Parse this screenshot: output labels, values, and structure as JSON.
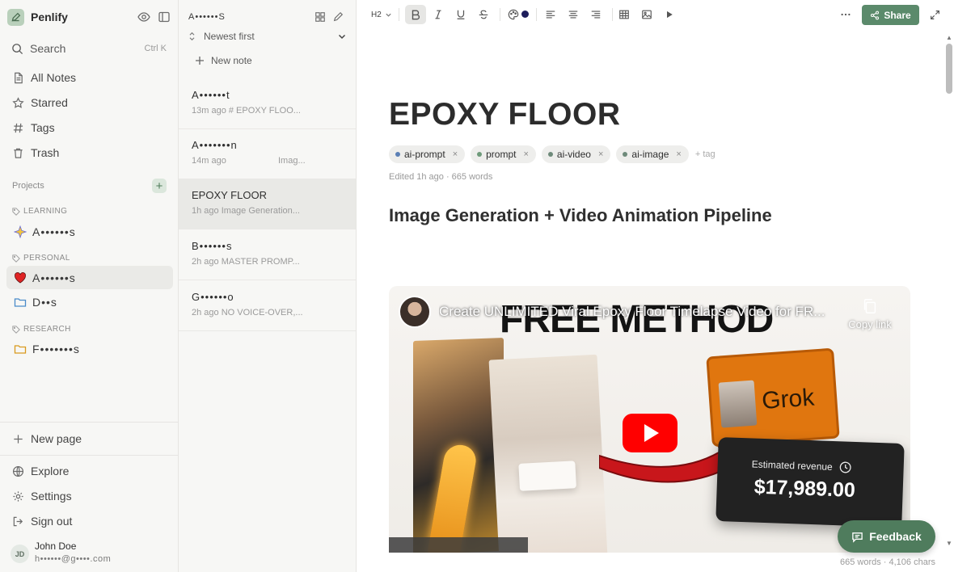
{
  "app": {
    "name": "Penlify"
  },
  "sidebar": {
    "search": {
      "label": "Search",
      "shortcut": "Ctrl K"
    },
    "nav": [
      {
        "label": "All Notes",
        "icon": "document-icon"
      },
      {
        "label": "Starred",
        "icon": "star-icon"
      },
      {
        "label": "Tags",
        "icon": "hash-icon"
      },
      {
        "label": "Trash",
        "icon": "trash-icon"
      }
    ],
    "projects_label": "Projects",
    "groups": [
      {
        "name": "LEARNING",
        "items": [
          {
            "label": "A••••••s",
            "icon": "sparkle-icon"
          }
        ]
      },
      {
        "name": "PERSONAL",
        "items": [
          {
            "label": "A••••••s",
            "icon": "heart-icon",
            "active": true
          },
          {
            "label": "D••s",
            "icon": "folder-icon"
          }
        ]
      },
      {
        "name": "RESEARCH",
        "items": [
          {
            "label": "F•••••••s",
            "icon": "folder-icon"
          }
        ]
      }
    ],
    "new_page": "New page",
    "footer": [
      {
        "label": "Explore",
        "icon": "globe-icon"
      },
      {
        "label": "Settings",
        "icon": "gear-icon"
      },
      {
        "label": "Sign out",
        "icon": "sign-out-icon"
      }
    ],
    "user": {
      "initials": "JD",
      "name": "John Doe",
      "email": "h••••••@g••••.com"
    }
  },
  "notelist": {
    "title": "A••••••S",
    "sort": "Newest first",
    "new_note": "New note",
    "notes": [
      {
        "title": "A••••••t",
        "time": "13m ago",
        "preview": "# EPOXY FLOO...",
        "extra": ""
      },
      {
        "title": "A•••••••n",
        "time": "14m ago",
        "preview": "",
        "extra": "Imag..."
      },
      {
        "title": "EPOXY FLOOR",
        "time": "1h ago",
        "preview": "Image Generation...",
        "extra": "",
        "active": true
      },
      {
        "title": "B••••••s",
        "time": "2h ago",
        "preview": "MASTER PROMP...",
        "extra": ""
      },
      {
        "title": "G••••••o",
        "time": "2h ago",
        "preview": "NO VOICE-OVER,...",
        "extra": ""
      }
    ]
  },
  "toolbar": {
    "heading_level": "H2",
    "share_label": "Share"
  },
  "editor": {
    "title": "EPOXY FLOOR",
    "tags": [
      {
        "label": "ai-prompt",
        "color": "#5b7fb5"
      },
      {
        "label": "prompt",
        "color": "#6e9a7a"
      },
      {
        "label": "ai-video",
        "color": "#6e8a7a"
      },
      {
        "label": "ai-image",
        "color": "#6e8a7a"
      }
    ],
    "add_tag": "+ tag",
    "edited": "Edited 1h ago · 665 words",
    "heading": "Image Generation + Video Animation Pipeline",
    "video": {
      "title": "Create UNLIMITED Viral Epoxy Floor Timelapse Video for FR...",
      "overlay": "FREE METHOD",
      "copy_link": "Copy link",
      "grok": "Grok",
      "revenue_label": "Estimated revenue",
      "revenue_value": "$17,989.00"
    },
    "stats": "665 words · 4,106 chars",
    "feedback": "Feedback"
  }
}
